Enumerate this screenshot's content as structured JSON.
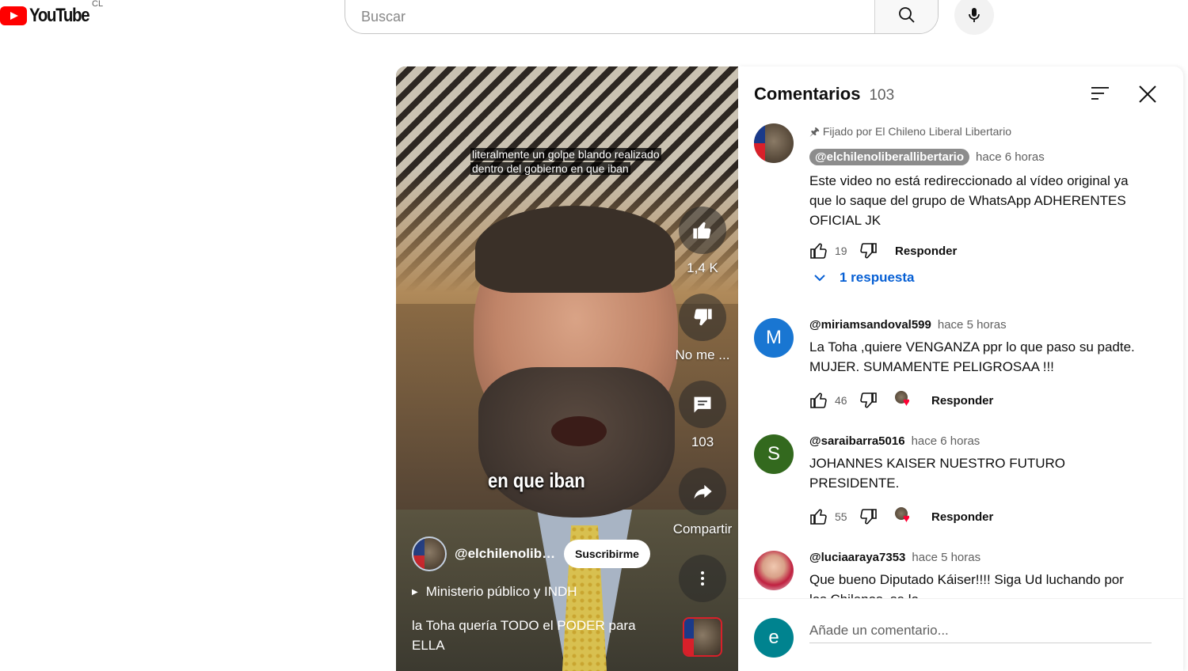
{
  "header": {
    "logo_text": "YouTube",
    "country_code": "CL",
    "search_placeholder": "Buscar",
    "search_icon": "search-icon",
    "mic_icon": "mic-icon"
  },
  "player": {
    "caption_top_line1": "literalmente un golpe blando realizado",
    "caption_top_line2": "dentro del gobierno en que iban",
    "caption_mid": "en que iban",
    "likes": "1,4 K",
    "dislike_label": "No me ...",
    "comments_count": "103",
    "share_label": "Compartir",
    "channel_name": "@elchilenolibe...",
    "subscribe_label": "Suscribirme",
    "playlist": "Ministerio público y INDH",
    "title": "la Toha quería TODO el PODER para ELLA"
  },
  "comments_panel": {
    "title": "Comentarios",
    "count": "103",
    "comments": [
      {
        "pinned_by": "Fijado por El Chileno Liberal Libertario",
        "author": "@elchilenoliberallibertario",
        "time": "hace 6 horas",
        "text": "Este video no está redireccionado al vídeo original ya que lo saque del grupo de WhatsApp ADHERENTES OFICIAL JK",
        "likes": "19",
        "reply_label": "Responder",
        "replies_label": "1 respuesta"
      },
      {
        "avatar_letter": "M",
        "avatar_color": "#1976d2",
        "author": "@miriamsandoval599",
        "time": "hace 5 horas",
        "text": "La Toha ,quiere VENGANZA ppr lo que paso su padte. MUJER. SUMAMENTE PELIGROSAA !!!",
        "likes": "46",
        "reply_label": "Responder"
      },
      {
        "avatar_letter": "S",
        "avatar_color": "#33691e",
        "author": "@saraibarra5016",
        "time": "hace 6 horas",
        "text": "JOHANNES KAISER NUESTRO FUTURO PRESIDENTE.",
        "likes": "55",
        "reply_label": "Responder"
      },
      {
        "author": "@luciaaraya7353",
        "time": "hace 5 horas",
        "text": "Que bueno Diputado Káiser!!!! Siga Ud luchando por los Chilenos, se lo"
      }
    ],
    "add_avatar_letter": "e",
    "add_avatar_color": "#00838f",
    "add_placeholder": "Añade un comentario..."
  }
}
